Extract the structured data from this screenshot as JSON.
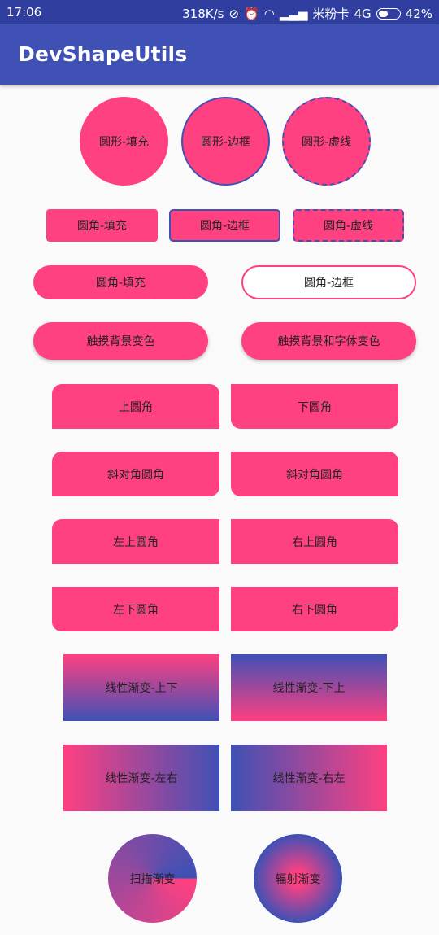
{
  "status_bar": {
    "time": "17:06",
    "network_speed": "318K/s",
    "carrier": "米粉卡",
    "network_type": "4G",
    "battery": "42%"
  },
  "app_bar": {
    "title": "DevShapeUtils"
  },
  "colors": {
    "accent": "#ff4081",
    "primary": "#3f51b5",
    "primary_dark": "#303f9f"
  },
  "shapes": {
    "circle_fill": "圆形-填充",
    "circle_stroke": "圆形-边框",
    "circle_dash": "圆形-虚线",
    "rect_fill": "圆角-填充",
    "rect_stroke": "圆角-边框",
    "rect_dash": "圆角-虚线",
    "pill_fill": "圆角-填充",
    "pill_stroke": "圆角-边框",
    "touch_bg": "触摸背景变色",
    "touch_bg_text": "触摸背景和字体变色",
    "top_round": "上圆角",
    "bottom_round": "下圆角",
    "diag_1": "斜对角圆角",
    "diag_2": "斜对角圆角",
    "top_left": "左上圆角",
    "top_right": "右上圆角",
    "bottom_left": "左下圆角",
    "bottom_right": "右下圆角",
    "linear_tb": "线性渐变-上下",
    "linear_bt": "线性渐变-下上",
    "linear_lr": "线性渐变-左右",
    "linear_rl": "线性渐变-右左",
    "sweep": "扫描渐变",
    "radial": "辐射渐变"
  }
}
